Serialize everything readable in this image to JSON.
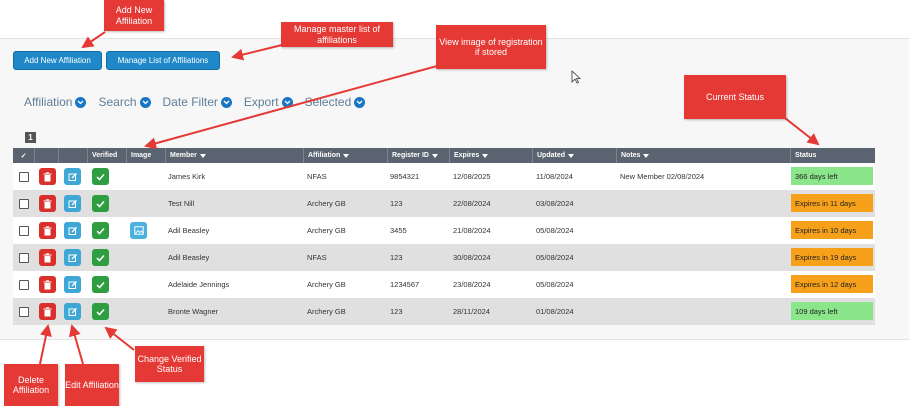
{
  "toolbar": {
    "add_label": "Add New Affiliation",
    "manage_label": "Manage List of Affiliations"
  },
  "filters": [
    "Affiliation",
    "Search",
    "Date Filter",
    "Export",
    "Selected"
  ],
  "pagination": {
    "page": "1"
  },
  "table": {
    "headers": {
      "check": "✓",
      "verified": "Verified",
      "image": "Image",
      "member": "Member",
      "affiliation": "Affiliation",
      "register_id": "Register ID",
      "expires": "Expires",
      "updated": "Updated",
      "notes": "Notes",
      "status": "Status"
    },
    "rows": [
      {
        "member": "James Kirk",
        "affiliation": "NFAS",
        "register_id": "9854321",
        "expires": "12/08/2025",
        "updated": "11/08/2024",
        "notes": "New Member 02/08/2024",
        "status": "366 days left",
        "status_kind": "ok",
        "has_image": false
      },
      {
        "member": "Test Nill",
        "affiliation": "Archery GB",
        "register_id": "123",
        "expires": "22/08/2024",
        "updated": "03/08/2024",
        "notes": "",
        "status": "Expires in 11 days",
        "status_kind": "warn",
        "has_image": false
      },
      {
        "member": "Adil Beasley",
        "affiliation": "Archery GB",
        "register_id": "3455",
        "expires": "21/08/2024",
        "updated": "05/08/2024",
        "notes": "",
        "status": "Expires in 10 days",
        "status_kind": "warn",
        "has_image": true
      },
      {
        "member": "Adil Beasley",
        "affiliation": "NFAS",
        "register_id": "123",
        "expires": "30/08/2024",
        "updated": "05/08/2024",
        "notes": "",
        "status": "Expires in 19 days",
        "status_kind": "warn",
        "has_image": false
      },
      {
        "member": "Adelaide Jennings",
        "affiliation": "Archery GB",
        "register_id": "1234567",
        "expires": "23/08/2024",
        "updated": "05/08/2024",
        "notes": "",
        "status": "Expires in 12 days",
        "status_kind": "warn",
        "has_image": false
      },
      {
        "member": "Bronte Wagner",
        "affiliation": "Archery GB",
        "register_id": "123",
        "expires": "28/11/2024",
        "updated": "01/08/2024",
        "notes": "",
        "status": "109 days left",
        "status_kind": "ok",
        "has_image": false
      }
    ]
  },
  "callouts": {
    "add_new": "Add New Affiliation",
    "manage": "Manage master list of affiliations",
    "view_image": "View image of registration if stored",
    "current_status": "Current Status",
    "change_verified": "Change Verified Status",
    "delete": "Delete Affiliation",
    "edit": "Edit Affiliation"
  },
  "colors": {
    "accent": "#1e88c9",
    "callout": "#e53935",
    "status_ok": "#8be58a",
    "status_warn": "#f7a11a",
    "delete": "#d9302b",
    "edit": "#3fa7d6",
    "verify": "#2f9e41"
  },
  "icons": {
    "filter_chevron": "chevron-down-icon",
    "column_filter": "funnel-icon",
    "delete": "trash-icon",
    "edit": "edit-icon",
    "verified": "check-icon",
    "image": "image-icon",
    "cursor": "mouse-pointer-icon"
  }
}
